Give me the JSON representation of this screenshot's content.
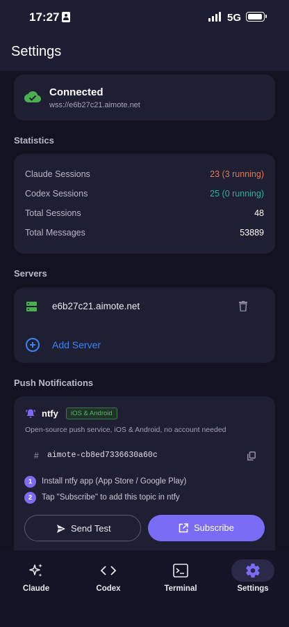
{
  "status_bar": {
    "time": "17:27",
    "network": "5G"
  },
  "header": {
    "title": "Settings"
  },
  "connection": {
    "status": "Connected",
    "url": "wss://e6b27c21.aimote.net",
    "status_color": "#4caf50"
  },
  "statistics": {
    "section_label": "Statistics",
    "rows": [
      {
        "label": "Claude Sessions",
        "value": "23 (3 running)",
        "color": "#e0785a"
      },
      {
        "label": "Codex Sessions",
        "value": "25 (0 running)",
        "color": "#2bb39a"
      },
      {
        "label": "Total Sessions",
        "value": "48",
        "color": "#ffffff"
      },
      {
        "label": "Total Messages",
        "value": "53889",
        "color": "#ffffff"
      }
    ]
  },
  "servers": {
    "section_label": "Servers",
    "items": [
      {
        "host": "e6b27c21.aimote.net"
      }
    ],
    "add_label": "Add Server"
  },
  "push": {
    "section_label": "Push Notifications",
    "provider": "ntfy",
    "badge": "iOS & Android",
    "description": "Open-source push service, iOS & Android, no account needed",
    "topic_prefix": "#",
    "topic": "aimote-cb8ed7336630a60c",
    "steps": [
      {
        "num": "1",
        "text": "Install ntfy app (App Store / Google Play)"
      },
      {
        "num": "2",
        "text": "Tap \"Subscribe\" to add this topic in ntfy"
      }
    ],
    "send_test_label": "Send Test",
    "subscribe_label": "Subscribe",
    "accent_color": "#7b6cf6"
  },
  "bottom_nav": {
    "items": [
      {
        "label": "Claude",
        "icon": "sparkle-icon"
      },
      {
        "label": "Codex",
        "icon": "code-brackets-icon"
      },
      {
        "label": "Terminal",
        "icon": "terminal-icon"
      },
      {
        "label": "Settings",
        "icon": "gear-icon",
        "active": true
      }
    ]
  }
}
